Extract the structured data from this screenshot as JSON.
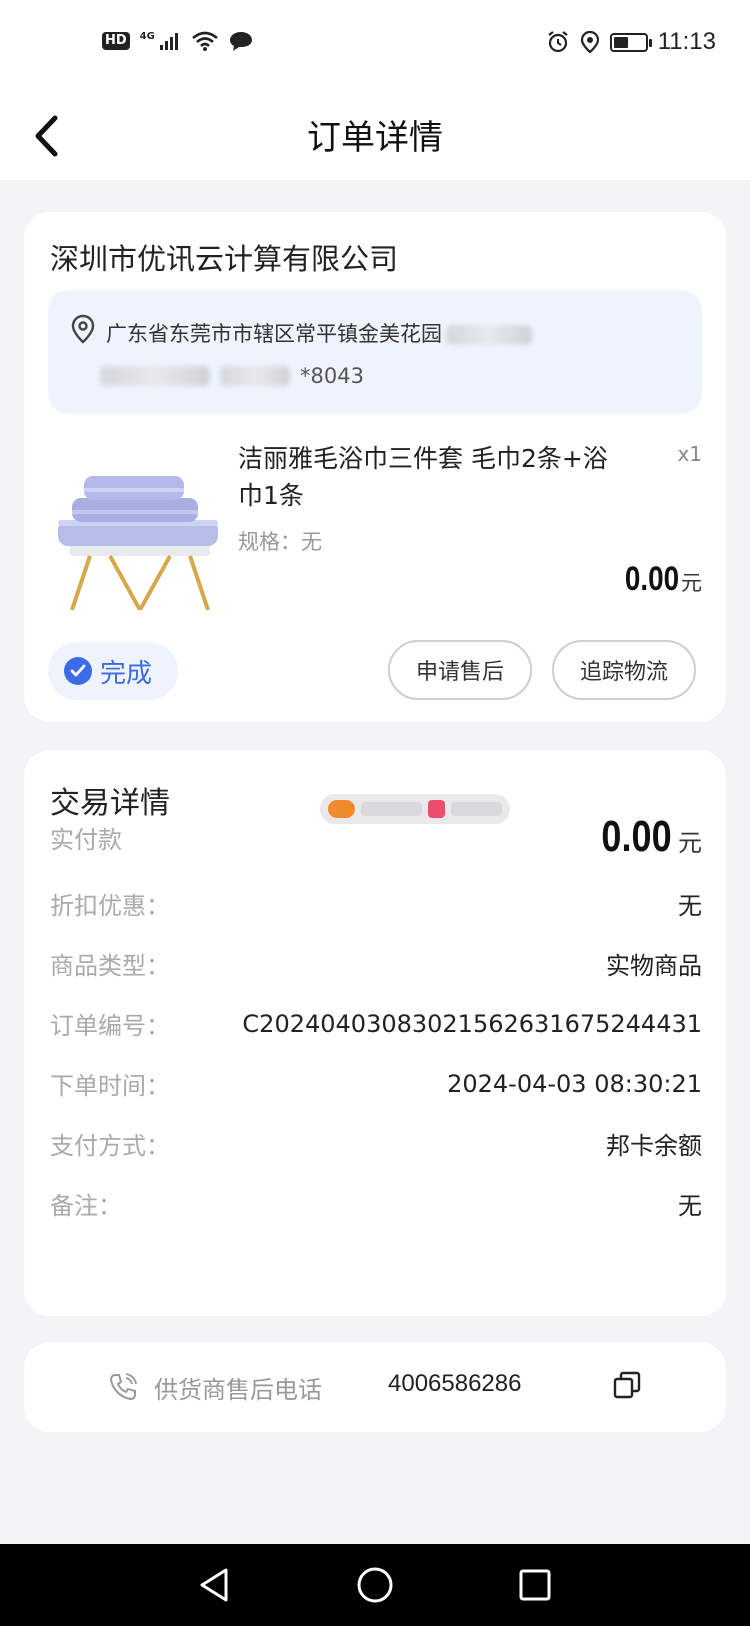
{
  "status_bar": {
    "network_badge": "HD",
    "network_type": "4G",
    "time": "11:13",
    "battery_level": 0.48
  },
  "header": {
    "title": "订单详情"
  },
  "order": {
    "shop_name": "深圳市优讯云计算有限公司",
    "address": {
      "line1": "广东省东莞市市辖区常平镇金美花园",
      "line2_suffix": "*8043"
    },
    "product": {
      "name": "洁丽雅毛浴巾三件套 毛巾2条+浴巾1条",
      "quantity": "x1",
      "spec": "规格：无",
      "price": "0.00",
      "price_unit": "元"
    },
    "status": "完成",
    "buttons": {
      "after_sales": "申请售后",
      "track_logistics": "追踪物流"
    }
  },
  "trade": {
    "title": "交易详情",
    "paid_label": "实付款",
    "paid_amount": "0.00",
    "paid_unit": "元",
    "rows": [
      {
        "label": "折扣优惠：",
        "value": "无"
      },
      {
        "label": "商品类型：",
        "value": "实物商品"
      },
      {
        "label": "订单编号：",
        "value": "C20240403083021562631675244431"
      },
      {
        "label": "下单时间：",
        "value": "2024-04-03 08:30:21"
      },
      {
        "label": "支付方式：",
        "value": "邦卡余额"
      },
      {
        "label": "备注：",
        "value": "无"
      }
    ]
  },
  "contact": {
    "label": "供货商售后电话",
    "number": "4006586286"
  },
  "colors": {
    "accent": "#3d6ce6",
    "address_bg": "#eef3fd",
    "page_bg": "#f3f4f6"
  }
}
